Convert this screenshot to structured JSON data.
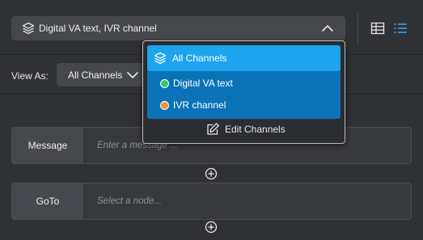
{
  "header": {
    "channel_select": {
      "value": "Digital VA text, IVR channel",
      "icon": "layers-icon",
      "expanded": true
    },
    "view_buttons": [
      {
        "name": "table-view",
        "icon": "table-icon",
        "active": false
      },
      {
        "name": "list-view",
        "icon": "list-icon",
        "active": true
      }
    ]
  },
  "view_as": {
    "label": "View As:",
    "value": "All Channels"
  },
  "nodes": [
    {
      "tag": "Message",
      "placeholder": "Enter a message ..."
    },
    {
      "tag": "GoTo",
      "placeholder": "Select a node..."
    }
  ],
  "dropdown": {
    "all_label": "All Channels",
    "items": [
      {
        "label": "Digital VA text",
        "color": "#3cc46a"
      },
      {
        "label": "IVR channel",
        "color": "#f2923c"
      }
    ],
    "edit_label": "Edit Channels"
  },
  "colors": {
    "accent": "#1ea4ec",
    "selection": "#0b72b8",
    "list_icon_active": "#3aa0e8"
  }
}
